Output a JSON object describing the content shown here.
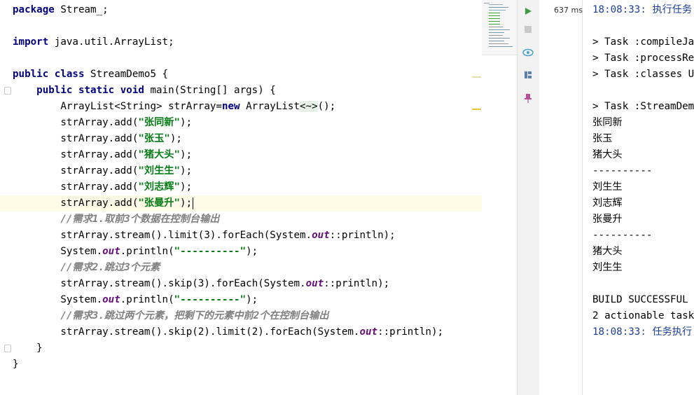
{
  "editor": {
    "package_kw": "package",
    "package_name": " Stream_;",
    "import_kw": "import",
    "import_name": " java.util.ArrayList;",
    "public_kw": "public",
    "class_kw": "class",
    "class_name": " StreamDemo5 {",
    "static_kw": "static",
    "void_kw": "void",
    "main_sig": " main(String[] args) {",
    "arraylist_decl_a": "ArrayList<String> strArray=",
    "new_kw": "new",
    "arraylist_decl_b": " ArrayList",
    "diamond_hint": "<~>",
    "arraylist_decl_c": "();",
    "add_prefix": "strArray.add(",
    "add_suffix": ");",
    "names": [
      "\"张同新\"",
      "\"张玉\"",
      "\"猪大头\"",
      "\"刘生生\"",
      "\"刘志辉\"",
      "\"张曼升\""
    ],
    "comment1": "//需求1.取前3个数据在控制台输出",
    "stmt_limit": [
      "strArray.stream().limit(",
      "3",
      ").forEach(System.",
      "out",
      "::println);"
    ],
    "println_prefix": "System.",
    "println_out": "out",
    "println_mid": ".println(",
    "dashes_str": "\"----------\"",
    "println_end": ");",
    "comment2": "//需求2.跳过3个元素",
    "stmt_skip": [
      "strArray.stream().skip(",
      "3",
      ").forEach(System.",
      "out",
      "::println);"
    ],
    "comment3": "//需求3.跳过两个元素，把剩下的元素中前2个在控制台输出",
    "stmt_skip_limit": [
      "strArray.stream().skip(",
      "2",
      ").limit(",
      "2",
      ").forEach(System.",
      "out",
      "::println);"
    ],
    "close_method": "}",
    "close_class": "}"
  },
  "run_panel": {
    "timing": "637 ms"
  },
  "console": {
    "lines": [
      "18:08:33: 执行任务",
      "",
      "> Task :compileJa",
      "> Task :processRe",
      "> Task :classes U",
      "",
      "> Task :StreamDem",
      "张同新",
      "张玉",
      "猪大头",
      "----------",
      "刘生生",
      "刘志辉",
      "张曼升",
      "----------",
      "猪大头",
      "刘生生",
      "",
      "BUILD SUCCESSFUL",
      "2 actionable task",
      "18:08:33: 任务执行"
    ]
  },
  "colors": {
    "keyword": "#000080",
    "string": "#067d17",
    "static_field": "#660e7a",
    "comment": "#808080",
    "run_green": "#3f9b3f",
    "timestamp_blue": "#1c3f95"
  },
  "icons": [
    "rerun-icon",
    "stop-icon",
    "eye-icon",
    "layout-icon",
    "pin-icon"
  ]
}
